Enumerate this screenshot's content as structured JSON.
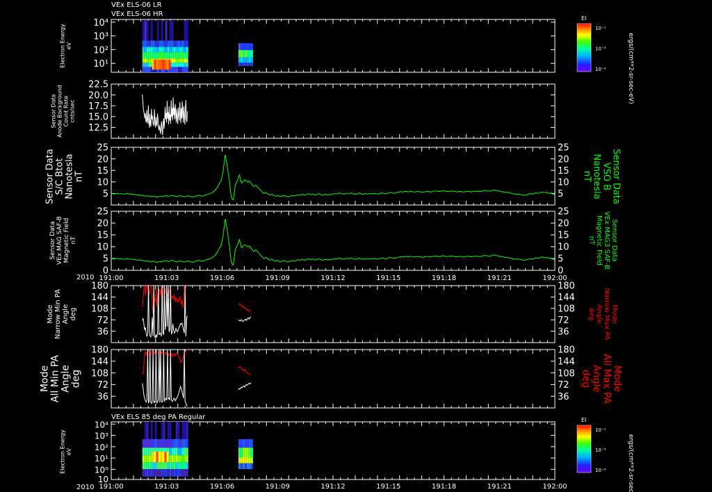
{
  "header": {
    "line1": "VEx ELS-06 LR",
    "line2": "VEx ELS-06 HR"
  },
  "bottom_panel_title": "VEx ELS 85 deg PA Regular",
  "year_label": "2010",
  "colors": {
    "background": "#000000",
    "axis": "#ffffff",
    "green": "#00ff00",
    "red": "#ff0000",
    "white": "#ffffff"
  },
  "chart_data": [
    {
      "type": "heatmap",
      "ylabel_lines": [
        "Electron Energy",
        "eV"
      ],
      "yticks": [
        "10⁴",
        "10³",
        "10²",
        "10¹"
      ],
      "scale": "log",
      "colorbar": {
        "label": "EI",
        "unit": "ergs/(cm**2-sr-sec-eV)",
        "ticks": [
          "10⁻¹",
          "10⁻⁵",
          "10⁻⁹"
        ]
      },
      "segments": [
        {
          "x0": "191:04.2",
          "x1": "191:10.3"
        },
        {
          "x0": "191:17.2",
          "x1": "191:19.0"
        }
      ]
    },
    {
      "type": "line",
      "ylabel_lines": [
        "Sensor Data",
        "Anode Background",
        "Count Rate",
        "cnts/sec"
      ],
      "yticks": [
        "22.5",
        "20.0",
        "17.5",
        "15.0",
        "12.5"
      ],
      "ylim": [
        10.0,
        22.5
      ],
      "series": [
        {
          "color": "#ffffff",
          "x0_min": 4.2,
          "x1_min": 10.3,
          "values": [
            20.1,
            18.6,
            17.0,
            16.2,
            15.4,
            14.6,
            15.8,
            14.0,
            13.6,
            16.5,
            14.2,
            13.4,
            17.6,
            14.0,
            12.4,
            15.6,
            13.3,
            12.7,
            16.8,
            14.4,
            15.2,
            13.5,
            12.9,
            14.1,
            16.7,
            13.1,
            12.5,
            14.9,
            13.2,
            12.8,
            15.7,
            14.4,
            12.6,
            11.8,
            13.0,
            12.1,
            11.0,
            12.6,
            13.9,
            11.9,
            10.7,
            13.2,
            14.6,
            12.2,
            13.8,
            17.2,
            14.4,
            15.8,
            13.6,
            18.6,
            14.6,
            16.0,
            13.2,
            17.4,
            14.1,
            15.5,
            13.4,
            18.8,
            14.9,
            16.9,
            14.2,
            19.4,
            15.3,
            17.1,
            14.4,
            17.9,
            15.5,
            13.6,
            16.8,
            14.8,
            13.3,
            17.1,
            15.5,
            14.1,
            18.3,
            16.1,
            13.5,
            17.0,
            14.6,
            18.5,
            15.5,
            13.6,
            17.4,
            15.1,
            13.2,
            16.8,
            18.8,
            14.4,
            13.7,
            16.2
          ]
        }
      ]
    },
    {
      "type": "line",
      "ylabel_lines": [
        "Sensor Data",
        "S/C Btot",
        "Nanotesla",
        "nT"
      ],
      "right_label_lines": [
        "Sensor Data",
        "VSO B",
        "Nanotesla",
        "nT"
      ],
      "yticks": [
        "25",
        "20",
        "15",
        "10",
        "5"
      ],
      "ylim": [
        0,
        25
      ],
      "series": [
        {
          "color": "#00ff00",
          "x0_min": 0,
          "x1_min": 60,
          "values": [
            5.0,
            4.8,
            4.9,
            5.1,
            4.8,
            4.9,
            4.7,
            4.8,
            5.0,
            4.8,
            4.6,
            4.7,
            4.5,
            4.3,
            4.4,
            4.2,
            4.0,
            3.8,
            4.0,
            3.7,
            3.6,
            3.9,
            3.4,
            3.5,
            3.8,
            3.6,
            3.9,
            4.1,
            3.7,
            4.0,
            4.2,
            3.9,
            3.6,
            3.8,
            4.1,
            3.7,
            3.5,
            3.8,
            4.0,
            3.6,
            3.4,
            3.7,
            3.9,
            4.2,
            4.0,
            3.8,
            4.3,
            4.5,
            4.7,
            5.1,
            5.6,
            6.3,
            7.5,
            9.2,
            10.5,
            14.8,
            21.8,
            17.0,
            11.0,
            3.2,
            2.2,
            9.0,
            10.6,
            13.0,
            9.5,
            10.5,
            10.8,
            9.9,
            10.3,
            9.0,
            8.0,
            8.6,
            7.8,
            6.8,
            5.8,
            5.0,
            5.4,
            4.8,
            4.3,
            4.7,
            4.0,
            3.8,
            4.2,
            3.6,
            3.9,
            4.2,
            3.7,
            3.5,
            3.8,
            4.1,
            3.9,
            4.2,
            4.5,
            4.3,
            4.7,
            4.2,
            4.6,
            4.9,
            4.5,
            4.8,
            4.3,
            4.6,
            4.9,
            4.5,
            4.2,
            4.7,
            4.5,
            4.4,
            4.6,
            4.8,
            4.9,
            4.8,
            5.3,
            4.9,
            4.7,
            4.8,
            5.1,
            4.9,
            5.3,
            4.8,
            4.6,
            4.9,
            5.2,
            4.8,
            4.6,
            5.0,
            4.7,
            5.0,
            4.8,
            5.1,
            4.9,
            4.7,
            5.0,
            5.2,
            5.0,
            4.8,
            5.2,
            5.5,
            5.2,
            5.0,
            5.3,
            5.5,
            5.8,
            5.6,
            5.8,
            5.9,
            5.7,
            6.0,
            5.8,
            5.6,
            5.8,
            5.9,
            5.7,
            5.5,
            5.7,
            5.9,
            5.8,
            5.6,
            5.9,
            6.1,
            6.0,
            5.8,
            6.0,
            6.2,
            6.0,
            5.8,
            5.9,
            6.1,
            6.0,
            5.8,
            5.7,
            5.9,
            5.8,
            5.6,
            5.8,
            6.0,
            5.8,
            5.7,
            5.9,
            6.0,
            5.9,
            5.8,
            6.0,
            6.2,
            6.3,
            6.1,
            6.0,
            6.2,
            6.5,
            6.3,
            6.1,
            6.0,
            5.8,
            5.6,
            5.4,
            5.5,
            5.2,
            5.0,
            4.8,
            4.6,
            4.8,
            4.5,
            4.4,
            4.2,
            4.5,
            4.7,
            4.9,
            4.7,
            5.0,
            5.3,
            5.0,
            5.4,
            5.7,
            5.3,
            5.6,
            5.0,
            5.2,
            4.7,
            4.5
          ]
        }
      ]
    },
    {
      "type": "line",
      "ylabel_lines": [
        "Sensor Data",
        "VEx MAG SAF-B",
        "Magnetic Field",
        "nT"
      ],
      "right_label_lines": [
        "Sensor Data",
        "VEx MAG3 SAF-B",
        "Magnetic Field",
        "nT"
      ],
      "yticks": [
        "25",
        "20",
        "15",
        "10",
        "5",
        "0"
      ],
      "ylim": [
        0,
        25
      ],
      "series": [
        {
          "color": "#00ff00",
          "x0_min": 0,
          "x1_min": 60,
          "copy_of_panel": 2
        }
      ]
    },
    {
      "type": "line",
      "ylabel_lines": [
        "Mode",
        "Narrow Min PA",
        "Angle",
        "deg"
      ],
      "right_label_lines": [
        "Mode",
        "Narrow Max PA",
        "Angle",
        "deg"
      ],
      "yticks": [
        "180",
        "144",
        "108",
        "72",
        "36"
      ],
      "ylim": [
        0,
        180
      ],
      "series": [
        {
          "name": "max",
          "color": "#ff0000",
          "segments": [
            {
              "x0_min": 4.2,
              "x1_min": 10.3,
              "values": [
                112,
                138,
                166,
                180,
                150,
                172,
                180,
                160,
                176,
                150,
                166,
                180,
                175,
                120,
                92,
                110,
                140,
                128,
                170,
                112,
                150,
                100,
                170,
                165,
                150,
                180,
                120,
                140,
                172,
                165,
                155,
                175,
                160,
                150,
                145,
                160,
                170,
                152,
                140,
                148,
                138,
                145,
                150,
                130,
                142,
                135,
                128,
                138,
                130,
                145,
                142,
                120,
                135,
                110,
                118,
                180,
                170,
                175,
                178,
                180
              ]
            },
            {
              "x0_min": 17.2,
              "x1_min": 18.9,
              "values": [
                124,
                120,
                122,
                116,
                118,
                112,
                114,
                108,
                110,
                104,
                106,
                100,
                102,
                98,
                96
              ]
            }
          ]
        },
        {
          "name": "min",
          "color": "#ffffff",
          "segments": [
            {
              "x0_min": 4.2,
              "x1_min": 10.3,
              "values": [
                70,
                76,
                60,
                40,
                48,
                30,
                20,
                26,
                180,
                40,
                22,
                18,
                30,
                80,
                20,
                180,
                22,
                14,
                26,
                16,
                30,
                180,
                24,
                30,
                28,
                20,
                180,
                30,
                26,
                180,
                40,
                60,
                180,
                50,
                180,
                34,
                40,
                180,
                28,
                30,
                60,
                40,
                30,
                35,
                45,
                38,
                34,
                40,
                48,
                52,
                60,
                58,
                62,
                50,
                40,
                30,
                180,
                20,
                76,
                84
              ]
            },
            {
              "x0_min": 17.2,
              "x1_min": 18.9,
              "values": [
                72,
                70,
                68,
                72,
                70,
                66,
                70,
                72,
                74,
                70,
                76,
                78,
                74,
                80,
                82
              ]
            }
          ]
        }
      ]
    },
    {
      "type": "line",
      "ylabel_lines": [
        "Mode",
        "All Min PA",
        "Angle",
        "deg"
      ],
      "right_label_lines": [
        "Mode",
        "All Max PA",
        "Angle",
        "deg"
      ],
      "yticks": [
        "180",
        "144",
        "108",
        "72",
        "36"
      ],
      "ylim": [
        0,
        180
      ],
      "series": [
        {
          "name": "max",
          "color": "#ff0000",
          "segments": [
            {
              "x0_min": 4.2,
              "x1_min": 10.3,
              "values": [
                110,
                105,
                130,
                165,
                175,
                160,
                172,
                168,
                176,
                160,
                172,
                165,
                175,
                178,
                170,
                174,
                165,
                172,
                168,
                176,
                170,
                165,
                172,
                175,
                168,
                172,
                166,
                174,
                170,
                168,
                165,
                172,
                168,
                162,
                166,
                160,
                165,
                170,
                162,
                166,
                158,
                164,
                168,
                160,
                165,
                170,
                168,
                162,
                158,
                150,
                145,
                140,
                148,
                152,
                160,
                165,
                170,
                175,
                178,
                180
              ]
            },
            {
              "x0_min": 17.2,
              "x1_min": 18.9,
              "values": [
                126,
                124,
                128,
                122,
                118,
                120,
                114,
                118,
                112,
                110,
                106,
                108,
                104,
                102,
                100
              ]
            }
          ]
        },
        {
          "name": "min",
          "color": "#ffffff",
          "segments": [
            {
              "x0_min": 4.2,
              "x1_min": 10.3,
              "values": [
                76,
                60,
                40,
                30,
                22,
                18,
                24,
                180,
                16,
                20,
                180,
                18,
                14,
                22,
                180,
                16,
                20,
                18,
                180,
                14,
                20,
                24,
                180,
                16,
                180,
                20,
                18,
                22,
                180,
                20,
                26,
                30,
                24,
                180,
                28,
                30,
                24,
                180,
                26,
                20,
                22,
                28,
                30,
                22,
                26,
                30,
                34,
                40,
                48,
                58,
                66,
                60,
                50,
                40,
                30,
                180,
                20,
                15,
                8,
                5
              ]
            },
            {
              "x0_min": 17.2,
              "x1_min": 18.9,
              "values": [
                56,
                60,
                58,
                64,
                62,
                66,
                68,
                64,
                70,
                72,
                70,
                74,
                76,
                74,
                78
              ]
            }
          ]
        }
      ]
    },
    {
      "type": "heatmap",
      "ylabel_lines": [
        "Electron Energy",
        "eV"
      ],
      "yticks": [
        "10⁴",
        "10³",
        "10²",
        "10¹",
        "10⁰",
        "10"
      ],
      "scale": "log",
      "colorbar": {
        "label": "EI",
        "unit": "ergs/(cm**2-sr-sec-eV)",
        "ticks": [
          "10⁻¹",
          "10⁻⁵",
          "10⁻⁹"
        ]
      },
      "segments": [
        {
          "x0": "191:04.2",
          "x1": "191:10.3"
        },
        {
          "x0": "191:17.2",
          "x1": "191:19.0"
        }
      ]
    }
  ],
  "time_axis": {
    "xlim_min": [
      0,
      60
    ],
    "ticks": [
      "191:00",
      "191:03",
      "191:06",
      "191:09",
      "191:12",
      "191:15",
      "191:18",
      "191:21",
      "192:00"
    ]
  }
}
